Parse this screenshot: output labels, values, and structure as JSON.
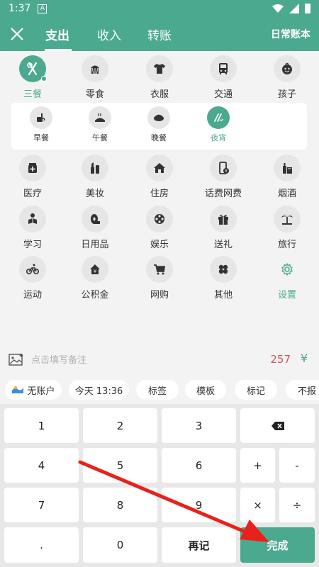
{
  "status_bar": {
    "time": "1:37",
    "badge": "A"
  },
  "header": {
    "tabs": [
      {
        "label": "支出"
      },
      {
        "label": "收入"
      },
      {
        "label": "转账"
      }
    ],
    "ledger": "日常账本"
  },
  "categories": {
    "row1": [
      {
        "label": "三餐",
        "icon": "fork-knife-icon",
        "selected": true
      },
      {
        "label": "零食",
        "icon": "snack-icon"
      },
      {
        "label": "衣服",
        "icon": "shirt-icon"
      },
      {
        "label": "交通",
        "icon": "bus-icon"
      },
      {
        "label": "孩子",
        "icon": "baby-icon"
      }
    ],
    "sub": [
      {
        "label": "早餐",
        "icon": "breakfast-icon"
      },
      {
        "label": "午餐",
        "icon": "lunch-icon"
      },
      {
        "label": "晚餐",
        "icon": "dinner-icon"
      },
      {
        "label": "夜宵",
        "icon": "late-snack-icon",
        "selected": true
      }
    ],
    "row2": [
      {
        "label": "医疗",
        "icon": "medicine-icon"
      },
      {
        "label": "美妆",
        "icon": "makeup-icon"
      },
      {
        "label": "住房",
        "icon": "house-icon"
      },
      {
        "label": "话费网费",
        "icon": "phone-bill-icon"
      },
      {
        "label": "烟酒",
        "icon": "tobacco-wine-icon"
      }
    ],
    "row3": [
      {
        "label": "学习",
        "icon": "study-icon"
      },
      {
        "label": "日用品",
        "icon": "toilet-paper-icon"
      },
      {
        "label": "娱乐",
        "icon": "film-reel-icon"
      },
      {
        "label": "送礼",
        "icon": "gift-icon"
      },
      {
        "label": "旅行",
        "icon": "palm-tree-icon"
      }
    ],
    "row4": [
      {
        "label": "运动",
        "icon": "bicycle-icon"
      },
      {
        "label": "公积金",
        "icon": "housing-fund-icon"
      },
      {
        "label": "网购",
        "icon": "cart-icon"
      },
      {
        "label": "其他",
        "icon": "clover-icon"
      },
      {
        "label": "设置",
        "icon": "gear-icon",
        "accent": true
      }
    ]
  },
  "note": {
    "placeholder": "点击填写备注",
    "amount": "257",
    "currency": "¥"
  },
  "chips": [
    {
      "label": "无账户"
    },
    {
      "label": "今天 13:36"
    },
    {
      "label": "标签"
    },
    {
      "label": "模板"
    },
    {
      "label": "标记"
    },
    {
      "label": "不报"
    }
  ],
  "keypad": {
    "k1": "1",
    "k2": "2",
    "k3": "3",
    "k4": "4",
    "k5": "5",
    "k6": "6",
    "k7": "7",
    "k8": "8",
    "k9": "9",
    "dot": ".",
    "k0": "0",
    "again": "再记",
    "plus": "+",
    "minus": "-",
    "times": "×",
    "divide": "÷",
    "done": "完成"
  },
  "colors": {
    "accent": "#4ba98f",
    "amount": "#d9534f",
    "arrow": "#e8211d"
  }
}
